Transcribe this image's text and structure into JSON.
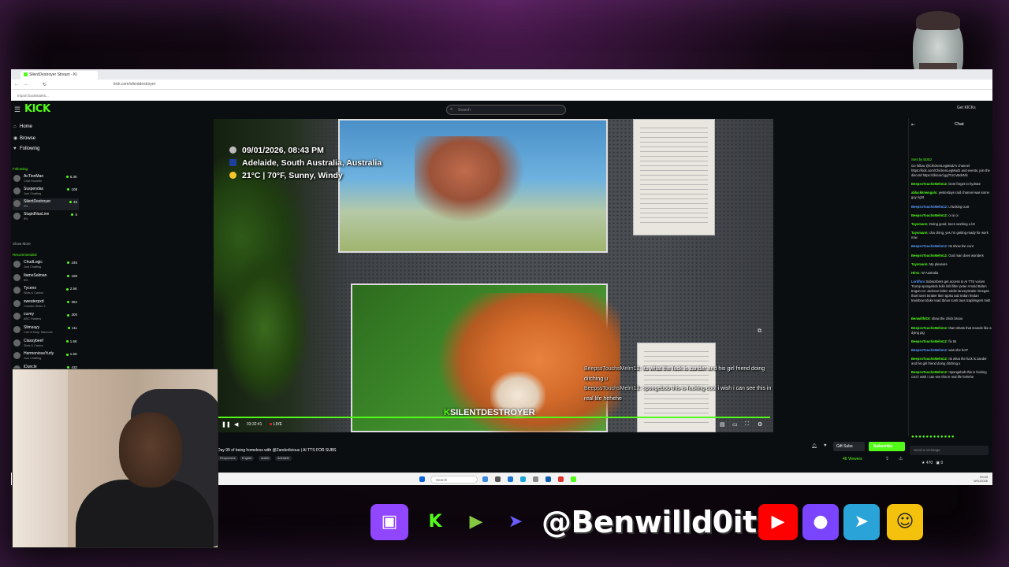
{
  "browser": {
    "tab_title": "SilentDestroyer Stream - Ki",
    "url": "kick.com/silentdestroyer",
    "bookmarks_label": "Import bookmarks..."
  },
  "kick": {
    "logo": "KICK",
    "search_placeholder": "Search",
    "get_kick": "Get KICKs",
    "brand_color": "#53fc18"
  },
  "sidebar": {
    "nav": [
      {
        "label": "Home",
        "icon": "home-icon"
      },
      {
        "label": "Browse",
        "icon": "compass-icon"
      },
      {
        "label": "Following",
        "icon": "heart-icon"
      }
    ],
    "following_title": "Following",
    "following": [
      {
        "name": "AcTionMan",
        "category": "Chat Roulette",
        "viewers": "6.3K"
      },
      {
        "name": "Suspendas",
        "category": "Just Chatting",
        "viewers": "108"
      },
      {
        "name": "SilentDestroyer",
        "category": "IRL",
        "viewers": "46"
      },
      {
        "name": "StupidNasLive",
        "category": "IRL",
        "viewers": "5"
      }
    ],
    "show_more": "Show More",
    "recommended_title": "Recommended",
    "recommended": [
      {
        "name": "ChudLogic",
        "category": "Just Chatting",
        "viewers": "245"
      },
      {
        "name": "ItameSalman",
        "category": "IRL",
        "viewers": "189"
      },
      {
        "name": "Tyceno",
        "category": "Slots & Casino",
        "viewers": "2.5K"
      },
      {
        "name": "sweaterpxd",
        "category": "Counter-Strike 2",
        "viewers": "384"
      },
      {
        "name": "cuvey",
        "category": "ARC Raiders",
        "viewers": "300"
      },
      {
        "name": "Slimsayy",
        "category": "Call of Duty: Warzone",
        "viewers": "111"
      },
      {
        "name": "Classybeef",
        "category": "Slots & Casino",
        "viewers": "1.6K"
      },
      {
        "name": "HarmoniousYurly",
        "category": "Just Chatting",
        "viewers": "1.5K"
      },
      {
        "name": "iDuncle",
        "category": "",
        "viewers": "432"
      }
    ]
  },
  "video": {
    "overlay": {
      "datetime": "09/01/2026, 08:43 PM",
      "location": "Adelaide, South Australia, Australia",
      "weather": "21°C | 70°F, Sunny, Windy"
    },
    "tts": [
      {
        "who": "BeepssTouchsMelm12:",
        "text": "its what the fuck is zander and his girl friend doing ditching u"
      },
      {
        "who": "BeepssTouchsMelm12:",
        "text": "spongebob this is fucking cool i wish i can see this in real life hehehe"
      }
    ],
    "watermark": "SILENTDESTROYER",
    "time": "03:32:41",
    "live": "LIVE",
    "progress": 1.0
  },
  "stream": {
    "title": "Day 99 of being homeless with @Zanderlicious | AI TTS FOR SUBS",
    "tags": [
      "Responsive",
      "English",
      "arabic",
      "Adelaide"
    ],
    "gift_subs": "Gift Subs",
    "subscribe": "Subscribe",
    "viewers": "46 Viewers"
  },
  "chat": {
    "title": "Chat",
    "pinned": "Sent by BizBz",
    "messages": [
      {
        "user": "",
        "text": "Go follow @ChickenLegModz's channel https://kick.com/ChickenLegModz and events, join the discord https://discord.gg/TUCvBdsNfc"
      },
      {
        "user": "BeepssTouchsMelm12:",
        "text": "Dont forget to hydrate"
      },
      {
        "user": "ablackknwngals:",
        "text": "yesterdays raid channel was some guy right"
      },
      {
        "user": "BeepssTouchsMelm12:",
        "text": "u fucking cunt"
      },
      {
        "user": "BeepssTouchsMelm12:",
        "text": "oi oi oi"
      },
      {
        "user": "Taysmann:",
        "text": "Doing good, been working a lot"
      },
      {
        "user": "Taysmann:",
        "text": "cha ching, yes I'm getting ready for work now"
      },
      {
        "user": "BeepssTouchsMelm12:",
        "text": "Its show the cunt"
      },
      {
        "user": "BeepssTouchsMelm12:",
        "text": "God man does wonders"
      },
      {
        "user": "Taysmann:",
        "text": "My pleasure"
      },
      {
        "user": "Hlrsc:",
        "text": "W Australia"
      },
      {
        "user": "Lordforx",
        "text": "Subscribers get access to AI TTS voices Trump spongebob bdin lofd filter peter Arnold Biden trogan Ice Jackson biden eddie lanceystraite imorgan thart tcent tnraker tkim tgoku tatz tedan fredan tnainbow tduke toad tbrian tcarti taus tcapbingers tosh"
      },
      {
        "user": "BenwillfdOt:",
        "text": "show the chick brooo"
      },
      {
        "user": "BeepssTouchsMelm12:",
        "text": "thart whats that sounds like a dying pig"
      },
      {
        "user": "BeepssTouchsMelm12:",
        "text": "fix tts"
      },
      {
        "user": "BeepssTouchsMelm12:",
        "text": "was she hot?"
      },
      {
        "user": "BeepssTouchsMelm12:",
        "text": "Its what the fuck is zander and his girl friend doing ditching u"
      },
      {
        "user": "BeepssTouchsMelm12:",
        "text": "!spongebob this is fucking cool i wish i can see this in real life hehehe"
      }
    ],
    "input_placeholder": "Send a message",
    "points": "470",
    "count": "0"
  },
  "taskbar": {
    "search_placeholder": "Search",
    "time": "20:43",
    "date": "9/01/2026"
  },
  "socials": {
    "handle": "@Benwilld0it",
    "items": [
      {
        "name": "twitch-icon",
        "color": "#9146ff"
      },
      {
        "name": "kick-icon",
        "color": "#53fc18"
      },
      {
        "name": "rumble-icon",
        "color": "#85c742"
      },
      {
        "name": "parti-icon",
        "color": "#6a5cff"
      },
      {
        "name": "youtube-icon",
        "color": "#ff0000"
      },
      {
        "name": "streamelements-icon",
        "color": "#7b45ff"
      },
      {
        "name": "telegram-icon",
        "color": "#2aa3d8"
      },
      {
        "name": "bot-icon",
        "color": "#f4c20d"
      }
    ]
  }
}
